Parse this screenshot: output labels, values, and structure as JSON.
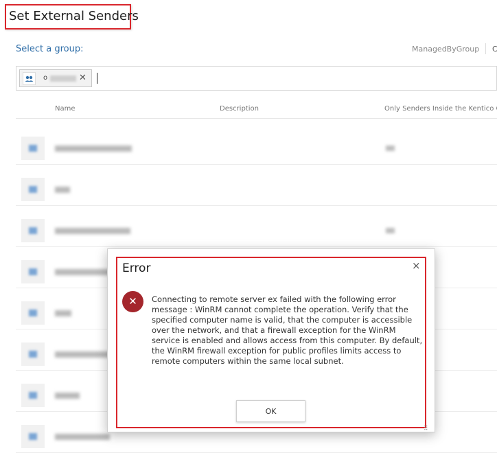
{
  "page": {
    "title": "Set External Senders",
    "select_label": "Select a group:",
    "managed_by_group": "ManagedByGroup",
    "extra_link": "C"
  },
  "picker": {
    "chip_text": "o",
    "chip_close": "✕"
  },
  "table": {
    "columns": [
      "Name",
      "Description",
      "Only Senders Inside the Kentico Or"
    ]
  },
  "dialog": {
    "title": "Error",
    "close": "×",
    "message": "Connecting to remote server ex  failed with the following error message : WinRM cannot complete the operation. Verify that the specified computer name is valid, that the computer is accessible over the network, and that a firewall exception for the WinRM service is enabled and allows access from this computer. By default, the WinRM firewall exception for public profiles limits access to remote computers within the same local subnet.",
    "error_icon": "✕",
    "ok_label": "OK"
  },
  "colors": {
    "accent": "#2f6ea8",
    "highlight": "#d9262c",
    "error": "#a4262c"
  }
}
